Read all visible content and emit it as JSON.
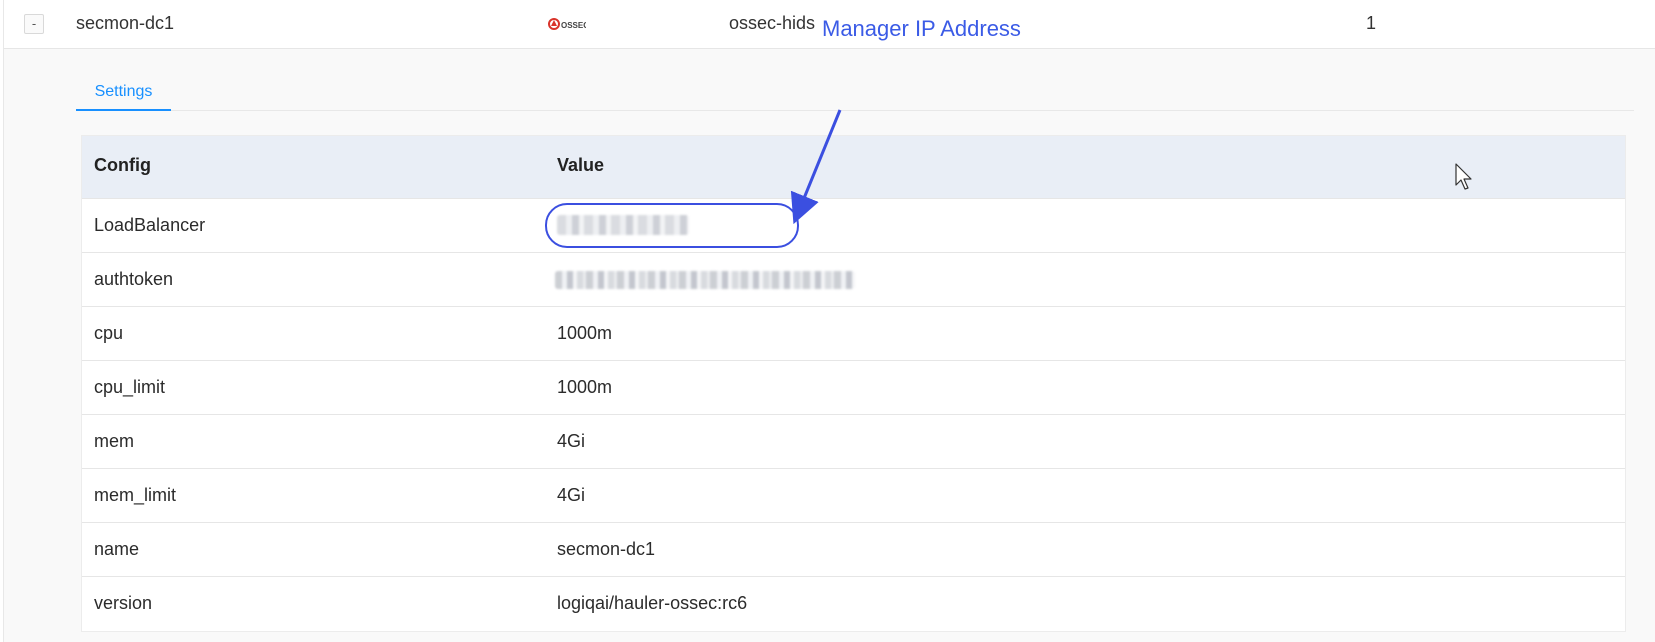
{
  "top_row": {
    "collapse_label": "-",
    "name": "secmon-dc1",
    "logo_text": "OSSEC",
    "type": "ossec-hids",
    "count": "1"
  },
  "tabs": [
    {
      "label": "Settings",
      "active": true
    }
  ],
  "annotation": {
    "text": "Manager IP Address",
    "color": "#3b5be6"
  },
  "table": {
    "headers": {
      "config": "Config",
      "value": "Value"
    },
    "rows": [
      {
        "key": "LoadBalancer",
        "value": "",
        "redacted": true
      },
      {
        "key": "authtoken",
        "value": "",
        "redacted": true
      },
      {
        "key": "cpu",
        "value": "1000m"
      },
      {
        "key": "cpu_limit",
        "value": "1000m"
      },
      {
        "key": "mem",
        "value": "4Gi"
      },
      {
        "key": "mem_limit",
        "value": "4Gi"
      },
      {
        "key": "name",
        "value": "secmon-dc1"
      },
      {
        "key": "version",
        "value": "logiqai/hauler-ossec:rc6"
      }
    ]
  },
  "colors": {
    "accent": "#1890ff",
    "header_bg": "#e9eef6",
    "annotation": "#3b4fe0"
  }
}
